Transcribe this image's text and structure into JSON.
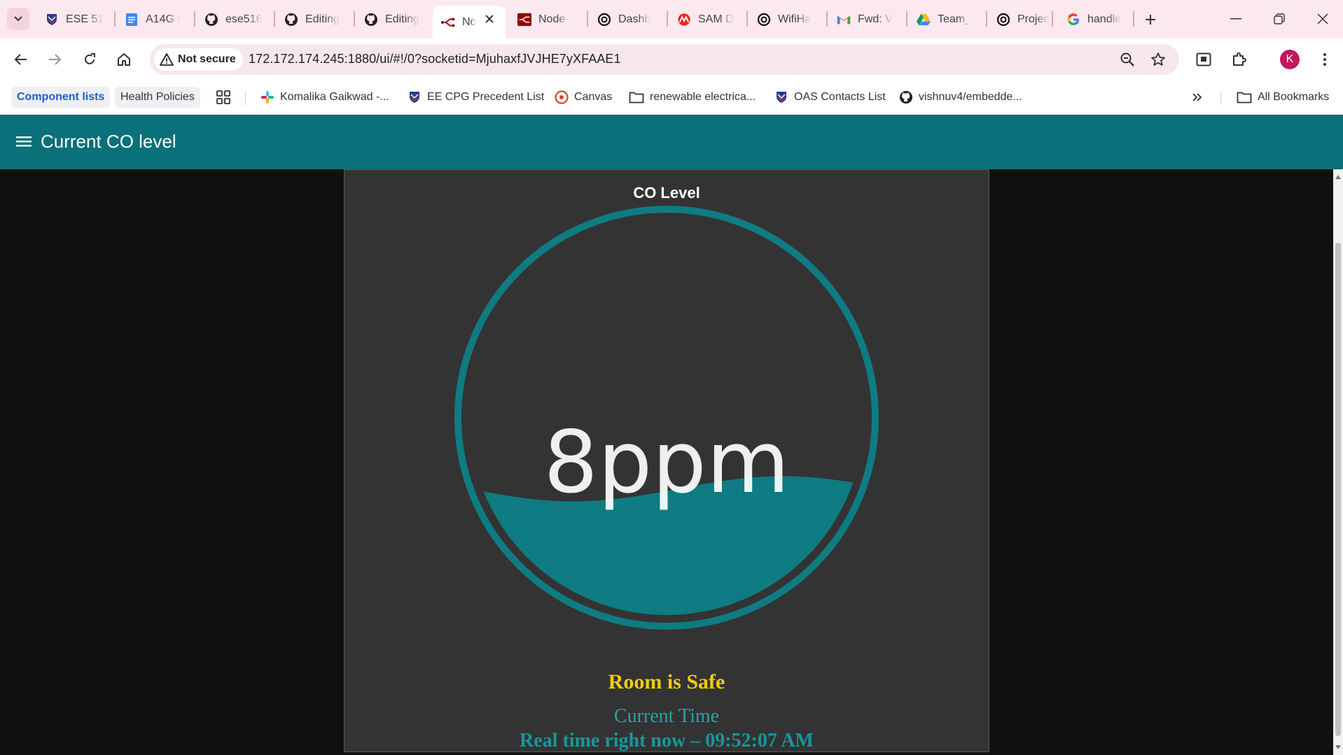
{
  "tabs": [
    {
      "title": "ESE 51",
      "icon": "penn-shield-icon"
    },
    {
      "title": "A14G f",
      "icon": "google-docs-icon"
    },
    {
      "title": "ese516",
      "icon": "github-icon"
    },
    {
      "title": "Editing",
      "icon": "github-icon"
    },
    {
      "title": "Editing",
      "icon": "github-icon"
    },
    {
      "title": "No",
      "icon": "node-red-icon",
      "active": true
    },
    {
      "title": "Node-",
      "icon": "node-red-dark-icon"
    },
    {
      "title": "Dashb",
      "icon": "openai-icon"
    },
    {
      "title": "SAM D",
      "icon": "microchip-icon"
    },
    {
      "title": "WifiHa",
      "icon": "openai-icon"
    },
    {
      "title": "Fwd: V",
      "icon": "gmail-icon"
    },
    {
      "title": "Team_",
      "icon": "google-drive-icon"
    },
    {
      "title": "Projec",
      "icon": "openai-icon"
    },
    {
      "title": "handle",
      "icon": "google-icon"
    }
  ],
  "omnibox": {
    "security_label": "Not secure",
    "url": "172.172.174.245:1880/ui/#!/0?socketid=MjuhaxfJVJHE7yXFAAE1"
  },
  "profile_initial": "K",
  "bookmarks": {
    "items": [
      "Component lists",
      "Health Policies",
      "Komalika Gaikwad -...",
      "EE CPG Precedent List",
      "Canvas",
      "renewable electrica...",
      "OAS Contacts List",
      "vishnuv4/embedde..."
    ],
    "all_bookmarks": "All Bookmarks"
  },
  "dashboard": {
    "page_title": "Current CO level",
    "card_title": "CO Level",
    "gauge_value": "8ppm",
    "gauge_fill_fraction": 0.32,
    "status": "Room is Safe",
    "time_label": "Current Time",
    "time_text": "Real time right now – 09:52:07 AM"
  },
  "colors": {
    "accent": "#0a7079",
    "gauge": "#0f7b82",
    "status": "#f2cc0c",
    "card": "#333333",
    "tabstrip": "#fce8ef"
  }
}
